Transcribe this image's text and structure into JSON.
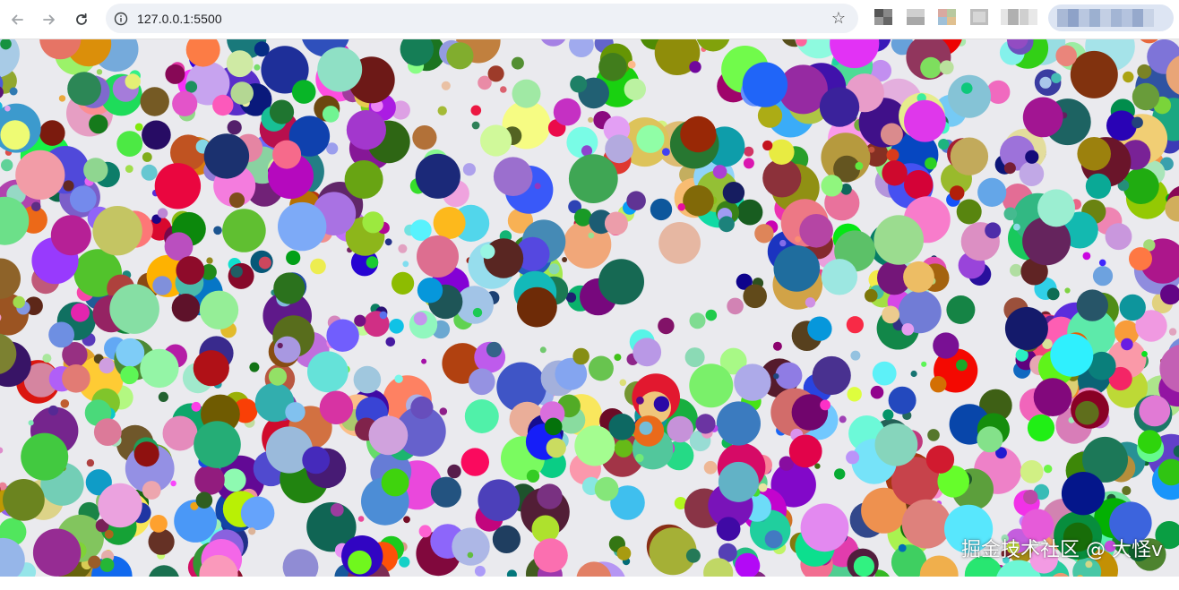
{
  "address_bar": {
    "url": "127.0.0.1:5500"
  },
  "toolbar": {
    "back_icon": "back-arrow-icon",
    "forward_icon": "forward-arrow-icon",
    "reload_icon": "reload-icon",
    "info_icon": "info-icon",
    "bookmark_icon": "star-icon"
  },
  "page": {
    "background_color": "#eaeaee",
    "content": "randomly placed colored circles",
    "watermark": "掘金技术社区 @ 大怪v"
  }
}
